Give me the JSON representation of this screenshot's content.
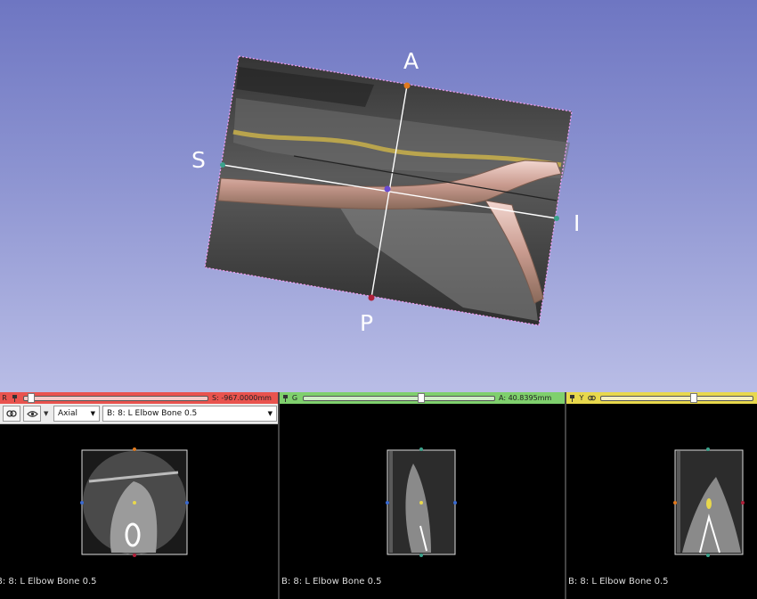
{
  "view3d": {
    "labels": {
      "anterior": "A",
      "superior": "S",
      "inferior": "I",
      "posterior": "P"
    }
  },
  "slice_views": {
    "red": {
      "letter": "R",
      "offset": "S: -967.0000mm",
      "orientation": "Axial",
      "volume": "B: 8: L Elbow Bone 0.5",
      "caption": "B: 8: L Elbow Bone 0.5",
      "slider_position": 0.03,
      "color": "#e9534e"
    },
    "green": {
      "letter": "G",
      "offset": "A: 40.8395mm",
      "caption": "B: 8: L Elbow Bone 0.5",
      "slider_position": 0.6,
      "color": "#7fd06d"
    },
    "yellow": {
      "letter": "Y",
      "caption": "B: 8: L Elbow Bone 0.5",
      "slider_position": 0.6,
      "color": "#e8d84c"
    }
  },
  "icons": {
    "pin": "pin-icon",
    "link": "link-icon",
    "visibility": "eye-icon",
    "dropdown": "chevron-down-icon"
  }
}
